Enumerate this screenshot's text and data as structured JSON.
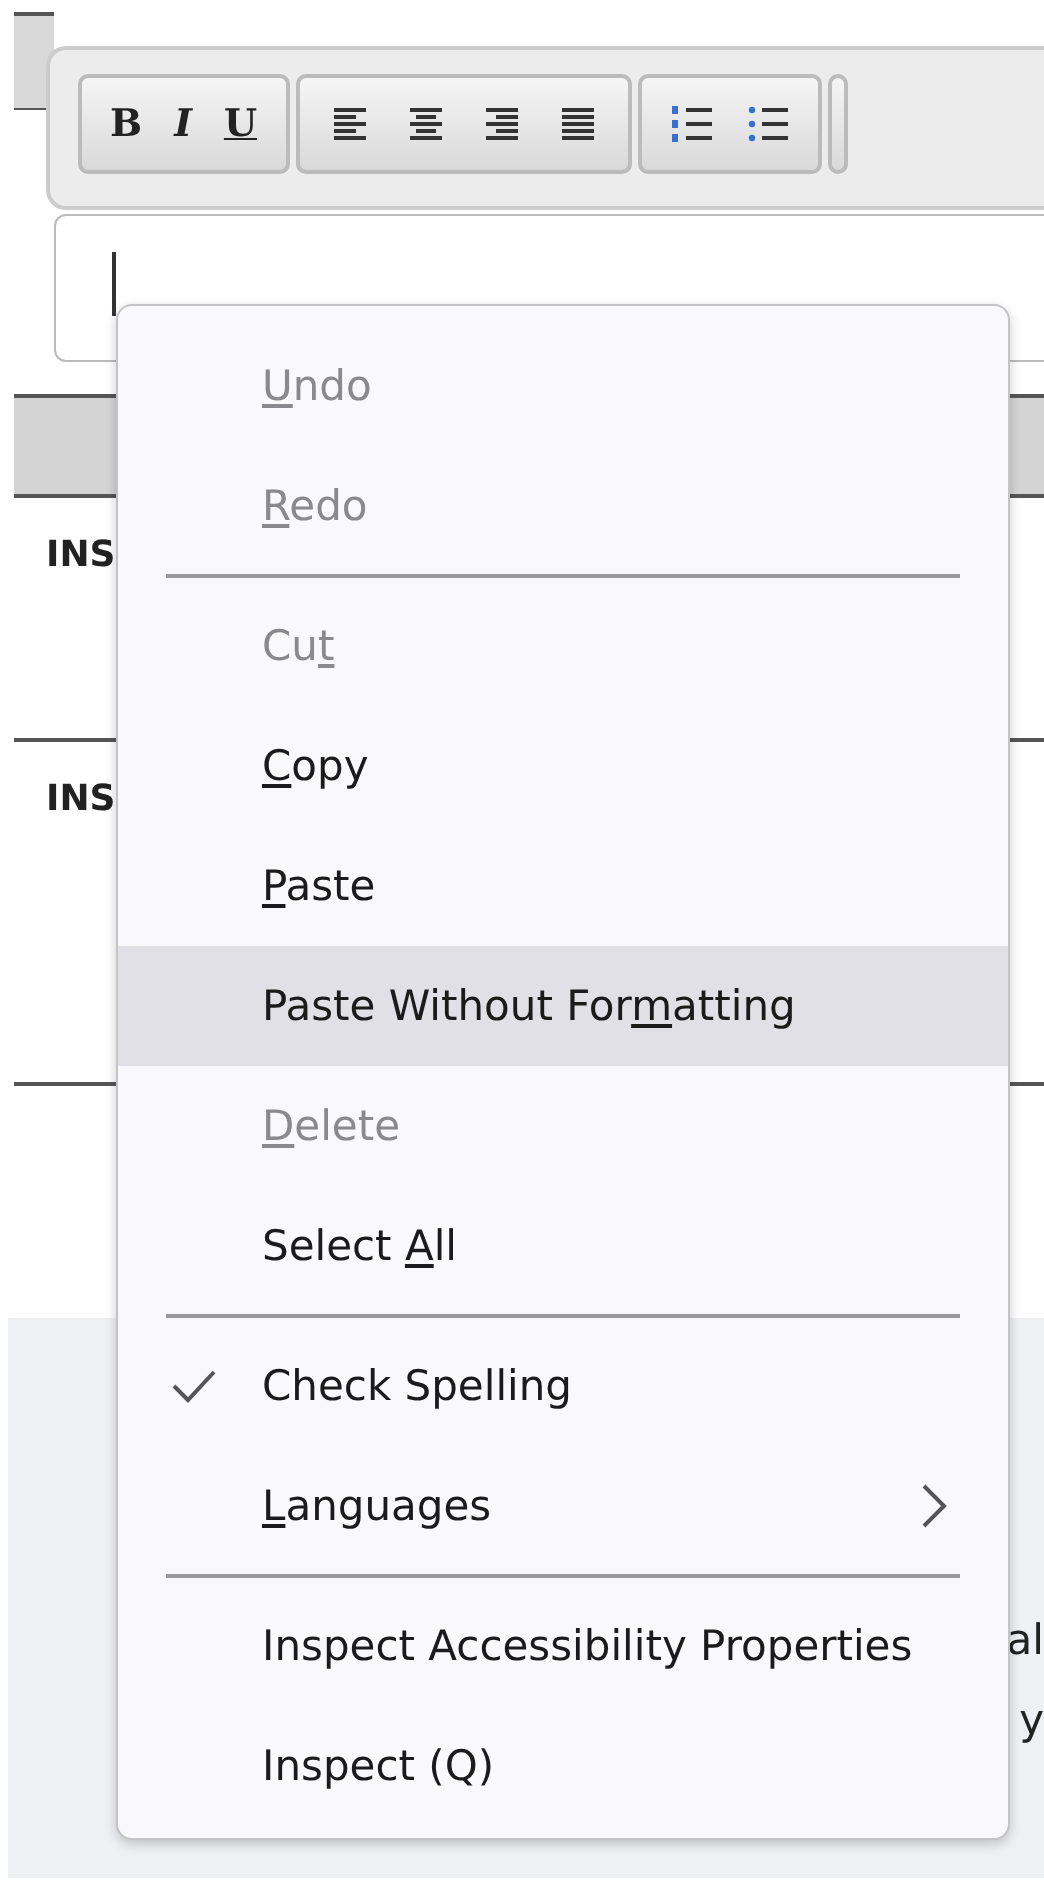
{
  "toolbar": {
    "groups": [
      {
        "buttons": [
          {
            "kind": "bold",
            "label": "B"
          },
          {
            "kind": "italic",
            "label": "I"
          },
          {
            "kind": "underline",
            "label": "U"
          }
        ]
      },
      {
        "buttons": [
          {
            "kind": "align-left"
          },
          {
            "kind": "align-center"
          },
          {
            "kind": "align-right"
          },
          {
            "kind": "justify"
          }
        ]
      },
      {
        "buttons": [
          {
            "kind": "numbered-list"
          },
          {
            "kind": "bulleted-list"
          }
        ]
      }
    ]
  },
  "table": {
    "rows": [
      {
        "cell": "INS"
      },
      {
        "cell": "INS"
      }
    ]
  },
  "footer_texts": [
    "al",
    "y"
  ],
  "context_menu": {
    "items": [
      {
        "kind": "item",
        "label": {
          "key": "U",
          "after": "ndo"
        },
        "disabled": true,
        "highlighted": false,
        "checked": false,
        "submenu": false
      },
      {
        "kind": "item",
        "label": {
          "key": "R",
          "after": "edo"
        },
        "disabled": true,
        "highlighted": false,
        "checked": false,
        "submenu": false
      },
      {
        "kind": "separator"
      },
      {
        "kind": "item",
        "label": {
          "before": "Cu",
          "key": "t"
        },
        "disabled": true,
        "highlighted": false,
        "checked": false,
        "submenu": false
      },
      {
        "kind": "item",
        "label": {
          "key": "C",
          "after": "opy"
        },
        "disabled": false,
        "highlighted": false,
        "checked": false,
        "submenu": false
      },
      {
        "kind": "item",
        "label": {
          "key": "P",
          "after": "aste"
        },
        "disabled": false,
        "highlighted": false,
        "checked": false,
        "submenu": false
      },
      {
        "kind": "item",
        "label": {
          "before": "Paste Without For",
          "key": "m",
          "after": "atting"
        },
        "disabled": false,
        "highlighted": true,
        "checked": false,
        "submenu": false
      },
      {
        "kind": "item",
        "label": {
          "key": "D",
          "after": "elete"
        },
        "disabled": true,
        "highlighted": false,
        "checked": false,
        "submenu": false
      },
      {
        "kind": "item",
        "label": {
          "before": "Select ",
          "key": "A",
          "after": "ll"
        },
        "disabled": false,
        "highlighted": false,
        "checked": false,
        "submenu": false
      },
      {
        "kind": "separator"
      },
      {
        "kind": "item",
        "label": {
          "before": "Check Spelling"
        },
        "disabled": false,
        "highlighted": false,
        "checked": true,
        "submenu": false
      },
      {
        "kind": "item",
        "label": {
          "key": "L",
          "after": "anguages"
        },
        "disabled": false,
        "highlighted": false,
        "checked": false,
        "submenu": true
      },
      {
        "kind": "separator"
      },
      {
        "kind": "item",
        "label": {
          "before": "Inspect Accessibility Properties"
        },
        "disabled": false,
        "highlighted": false,
        "checked": false,
        "submenu": false
      },
      {
        "kind": "item",
        "label": {
          "before": "Inspect (Q)"
        },
        "disabled": false,
        "highlighted": false,
        "checked": false,
        "submenu": false
      }
    ]
  }
}
